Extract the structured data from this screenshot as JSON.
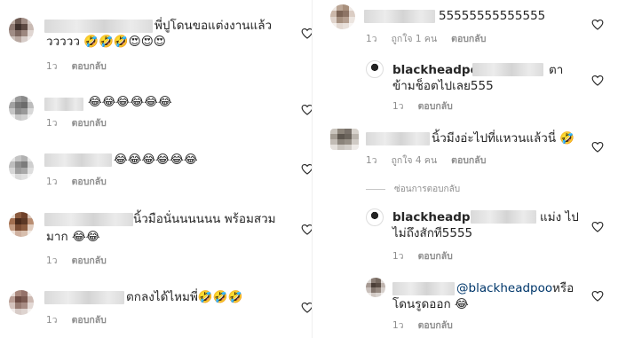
{
  "left": [
    {
      "line1": "พี่ปูโดนขอแต่งงานแล้ว",
      "line2": "ววววว 🤣🤣🤣😍😍😍",
      "time": "1ว",
      "reply_label": "ตอบกลับ"
    },
    {
      "line1": "😂😂😂😂😂😂",
      "time": "1ว",
      "reply_label": "ตอบกลับ"
    },
    {
      "line1": "😂😂😂😂😂😂",
      "time": "1ว",
      "reply_label": "ตอบกลับ"
    },
    {
      "line1": "นิ้วมือนั่นนนนนน พร้อมสวม",
      "line2": "มาก 😂😂",
      "time": "1ว",
      "reply_label": "ตอบกลับ"
    },
    {
      "line1": "ตกลงได้ไหมพี่🤣🤣🤣",
      "time": "1ว",
      "reply_label": "ตอบกลับ"
    }
  ],
  "right": [
    {
      "line1": "55555555555555",
      "time": "1ว",
      "likes": "ถูกใจ 1 คน",
      "reply_label": "ตอบกลับ"
    },
    {
      "username": "blackheadpoo",
      "line1_tail": "ตา",
      "line2": "ข้ามช็อตไปเลย555",
      "time": "1ว",
      "reply_label": "ตอบกลับ"
    },
    {
      "line1": "นิ้วมีงอ่ะไปที่แหวนแล้วนี่ 🤣",
      "time": "1ว",
      "likes": "ถูกใจ 4 คน",
      "reply_label": "ตอบกลับ"
    },
    {
      "hide_replies": "ซ่อนการตอบกลับ"
    },
    {
      "username": "blackheadpoo",
      "line1_tail": "แม่ง ไป",
      "line2": "ไม่ถึงสักที5555",
      "time": "1ว",
      "reply_label": "ตอบกลับ"
    },
    {
      "mention": "@blackheadpoo",
      "line1_tail": "หรือ",
      "line2": "โดนรูดออก 😂",
      "time": "1ว",
      "reply_label": "ตอบกลับ"
    }
  ],
  "colors": {
    "text": "#262626",
    "meta": "#8e8e8e",
    "mention": "#00376b"
  },
  "icons": {
    "like": "heart-outline-icon"
  }
}
